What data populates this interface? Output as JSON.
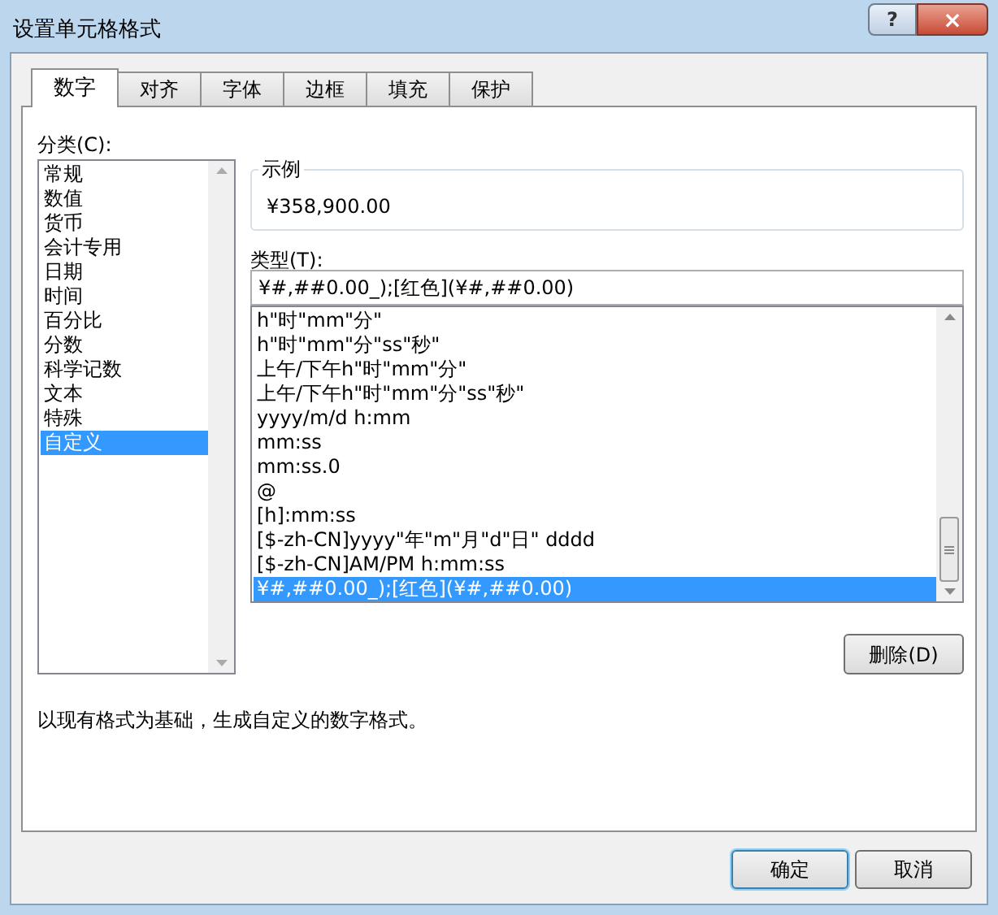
{
  "window": {
    "title": "设置单元格格式"
  },
  "title_buttons": [
    "?",
    "×"
  ],
  "tabs": [
    {
      "label": "数字",
      "selected": true
    },
    {
      "label": "对齐",
      "selected": false
    },
    {
      "label": "字体",
      "selected": false
    },
    {
      "label": "边框",
      "selected": false
    },
    {
      "label": "填充",
      "selected": false
    },
    {
      "label": "保护",
      "selected": false
    }
  ],
  "category": {
    "label": "分类(C):",
    "items": [
      {
        "label": "常规",
        "selected": false
      },
      {
        "label": "数值",
        "selected": false
      },
      {
        "label": "货币",
        "selected": false
      },
      {
        "label": "会计专用",
        "selected": false
      },
      {
        "label": "日期",
        "selected": false
      },
      {
        "label": "时间",
        "selected": false
      },
      {
        "label": "百分比",
        "selected": false
      },
      {
        "label": "分数",
        "selected": false
      },
      {
        "label": "科学记数",
        "selected": false
      },
      {
        "label": "文本",
        "selected": false
      },
      {
        "label": "特殊",
        "selected": false
      },
      {
        "label": "自定义",
        "selected": true
      }
    ]
  },
  "sample": {
    "label": "示例",
    "value": "¥358,900.00"
  },
  "type": {
    "label": "类型(T):",
    "value": "¥#,##0.00_);[红色](¥#,##0.00)",
    "items": [
      {
        "label": "h\"时\"mm\"分\"",
        "selected": false
      },
      {
        "label": "h\"时\"mm\"分\"ss\"秒\"",
        "selected": false
      },
      {
        "label": "上午/下午h\"时\"mm\"分\"",
        "selected": false
      },
      {
        "label": "上午/下午h\"时\"mm\"分\"ss\"秒\"",
        "selected": false
      },
      {
        "label": "yyyy/m/d h:mm",
        "selected": false
      },
      {
        "label": "mm:ss",
        "selected": false
      },
      {
        "label": "mm:ss.0",
        "selected": false
      },
      {
        "label": "@",
        "selected": false
      },
      {
        "label": "[h]:mm:ss",
        "selected": false
      },
      {
        "label": "[$-zh-CN]yyyy\"年\"m\"月\"d\"日\" dddd",
        "selected": false
      },
      {
        "label": "[$-zh-CN]AM/PM h:mm:ss",
        "selected": false
      },
      {
        "label": "¥#,##0.00_);[红色](¥#,##0.00)",
        "selected": true
      }
    ]
  },
  "delete_button": "删除(D)",
  "description": "以现有格式为基础，生成自定义的数字格式。",
  "buttons": [
    {
      "label": "确定",
      "default": true
    },
    {
      "label": "取消",
      "default": false
    }
  ]
}
